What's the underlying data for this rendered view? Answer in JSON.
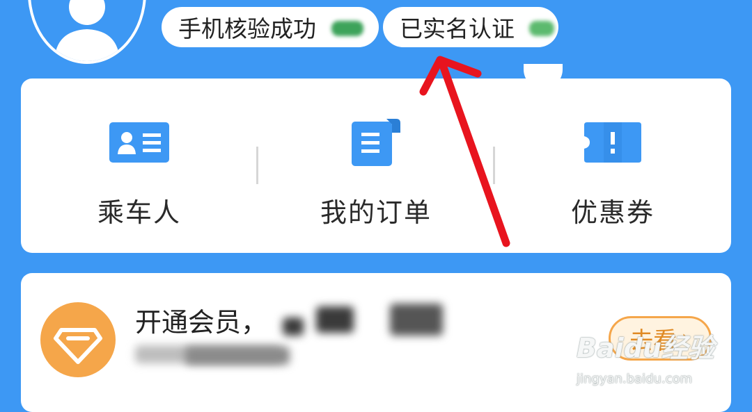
{
  "header": {
    "phone_badge": "手机核验成功",
    "realname_badge": "已实名认证"
  },
  "menu": {
    "items": [
      {
        "label": "乘车人",
        "icon": "passenger-card-icon"
      },
      {
        "label": "我的订单",
        "icon": "order-document-icon"
      },
      {
        "label": "优惠券",
        "icon": "coupon-ticket-icon"
      }
    ]
  },
  "member": {
    "title": "开通会员，",
    "view_label": "去看",
    "icon": "diamond-icon"
  },
  "watermark": {
    "logo": "Baidu经验",
    "url": "jingyan.baidu.com"
  },
  "colors": {
    "background": "#3d98f4",
    "icon_blue": "#3d98f4",
    "member_orange": "#f5a64a",
    "annotation_red": "#e8141e"
  }
}
